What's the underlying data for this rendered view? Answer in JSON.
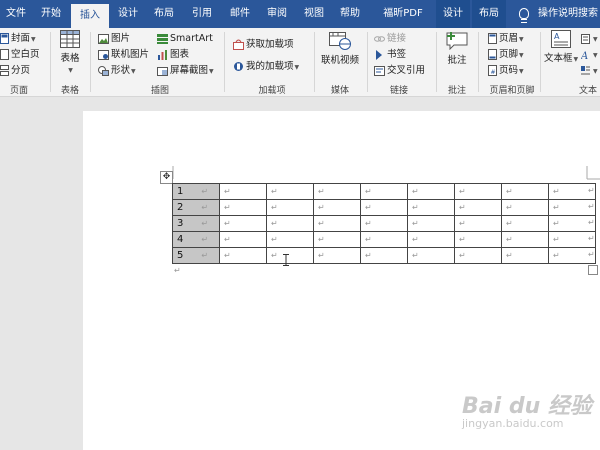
{
  "tabs": [
    "文件",
    "开始",
    "插入",
    "设计",
    "布局",
    "引用",
    "邮件",
    "审阅",
    "视图",
    "帮助",
    "福昕PDF",
    "设计",
    "布局"
  ],
  "tell_me": "操作说明搜索",
  "ribbon": {
    "pages": {
      "items": [
        "封面",
        "空白页",
        "分页"
      ],
      "label": "页面"
    },
    "tables": {
      "button": "表格",
      "label": "表格"
    },
    "illustrations": {
      "items": [
        "图片",
        "联机图片",
        "形状",
        "SmartArt",
        "图表",
        "屏幕截图"
      ],
      "label": "插图"
    },
    "addins": {
      "items": [
        "获取加载项",
        "我的加载项"
      ],
      "label": "加载项"
    },
    "media": {
      "button": "联机视频",
      "label": "媒体"
    },
    "links": {
      "items": [
        "链接",
        "书签",
        "交叉引用"
      ],
      "label": "链接"
    },
    "comments": {
      "button": "批注",
      "label": "批注"
    },
    "header_footer": {
      "items": [
        "页眉",
        "页脚",
        "页码"
      ],
      "label": "页眉和页脚"
    },
    "text": {
      "button": "文本框",
      "label": "文本"
    }
  },
  "table": {
    "row_numbers": [
      "1",
      "2",
      "3",
      "4",
      "5"
    ],
    "paragraph_mark": "↵",
    "columns": 9
  },
  "watermark": {
    "main": "Bai du 经验",
    "sub": "jingyan.baidu.com"
  }
}
